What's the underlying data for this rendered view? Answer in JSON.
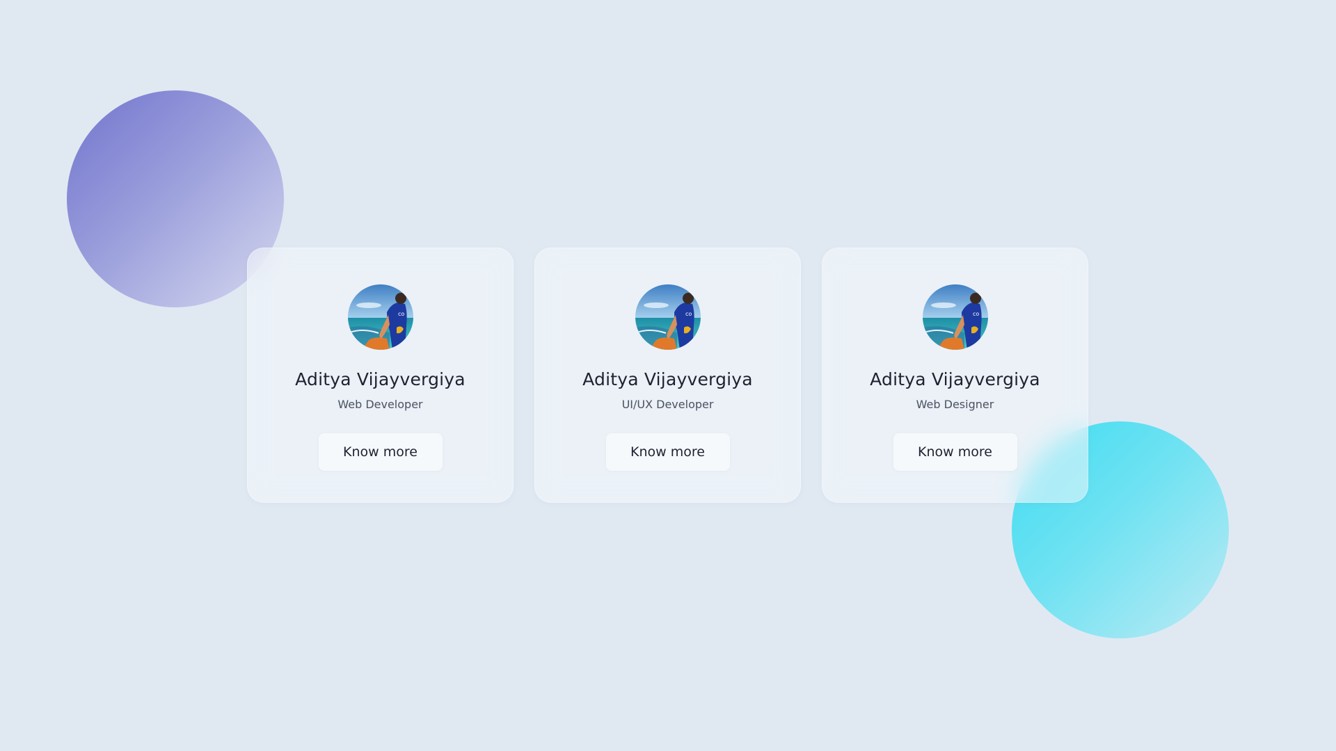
{
  "colors": {
    "background": "#e0e9f2",
    "blob_purple": "#7274cd",
    "blob_cyan": "#3ddcf1",
    "card_bg": "#f1f5f9",
    "text_primary": "#1e2230",
    "text_secondary": "#4b5160"
  },
  "profiles": [
    {
      "avatar_icon": "profile-photo-beach",
      "name": "Aditya Vijayvergiya",
      "role": "Web Developer",
      "button_label": "Know more"
    },
    {
      "avatar_icon": "profile-photo-beach",
      "name": "Aditya Vijayvergiya",
      "role": "UI/UX Developer",
      "button_label": "Know more"
    },
    {
      "avatar_icon": "profile-photo-beach",
      "name": "Aditya Vijayvergiya",
      "role": "Web Designer",
      "button_label": "Know more"
    }
  ]
}
